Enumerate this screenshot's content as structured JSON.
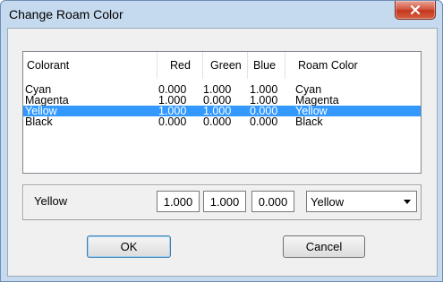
{
  "window": {
    "title": "Change Roam Color",
    "close_label": "x"
  },
  "list": {
    "columns": [
      "Colorant",
      "Red",
      "Green",
      "Blue",
      "Roam Color"
    ],
    "rows": [
      {
        "colorant": "Cyan",
        "red": "0.000",
        "green": "1.000",
        "blue": "1.000",
        "roam": "Cyan",
        "selected": false
      },
      {
        "colorant": "Magenta",
        "red": "1.000",
        "green": "0.000",
        "blue": "1.000",
        "roam": "Magenta",
        "selected": false
      },
      {
        "colorant": "Yellow",
        "red": "1.000",
        "green": "1.000",
        "blue": "0.000",
        "roam": "Yellow",
        "selected": true
      },
      {
        "colorant": "Black",
        "red": "0.000",
        "green": "0.000",
        "blue": "0.000",
        "roam": "Black",
        "selected": false
      }
    ]
  },
  "editor": {
    "colorant_label": "Yellow",
    "red_value": "1.000",
    "green_value": "1.000",
    "blue_value": "0.000",
    "roam_color_value": "Yellow"
  },
  "buttons": {
    "ok_label": "OK",
    "cancel_label": "Cancel"
  },
  "colors": {
    "selection": "#3399ff",
    "frame": "#c6daef",
    "close_button": "#c3361d"
  }
}
